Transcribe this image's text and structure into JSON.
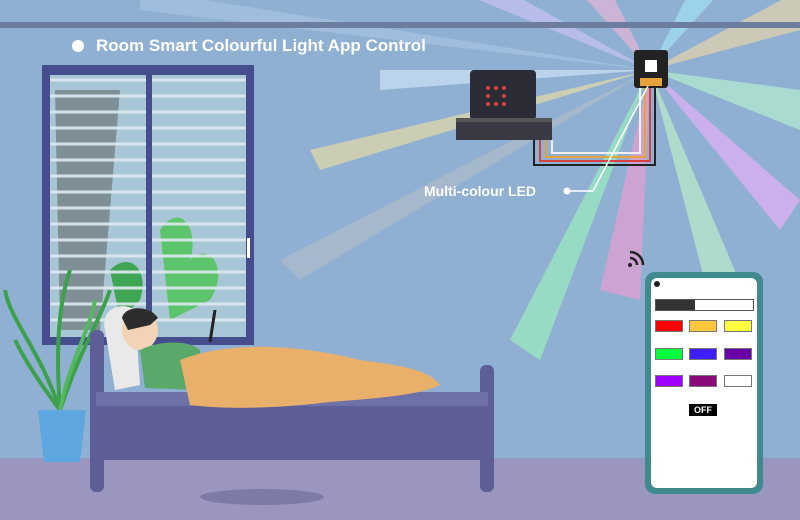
{
  "title": "Room Smart Colourful Light App Control",
  "led_label": "Multi-colour LED",
  "phone": {
    "brightness_level": 0.4,
    "swatches": [
      {
        "name": "red",
        "color": "#ff0000"
      },
      {
        "name": "orange",
        "color": "#ffc83c"
      },
      {
        "name": "yellow",
        "color": "#ffff40"
      },
      {
        "name": "green",
        "color": "#00ff3c"
      },
      {
        "name": "blue",
        "color": "#3c1eff"
      },
      {
        "name": "indigo",
        "color": "#6a00a8"
      },
      {
        "name": "purple",
        "color": "#a000ff"
      },
      {
        "name": "magenta",
        "color": "#8a0a7a"
      },
      {
        "name": "white",
        "color": "#ffffff"
      }
    ],
    "off_label": "OFF"
  },
  "colors": {
    "wall": "#8fb0d3",
    "floor": "#9a96c0",
    "phone_case": "#3f8a8c",
    "bed": "#5d5e95",
    "blanket": "#e8b06a",
    "window_frame": "#454d8c"
  }
}
